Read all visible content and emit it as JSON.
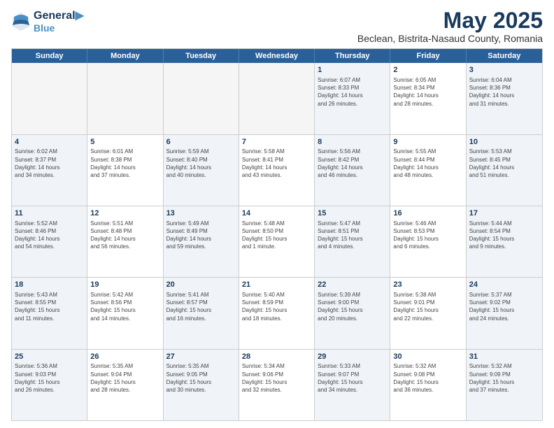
{
  "logo": {
    "line1": "General",
    "line2": "Blue"
  },
  "title": "May 2025",
  "subtitle": "Beclean, Bistrita-Nasaud County, Romania",
  "header_days": [
    "Sunday",
    "Monday",
    "Tuesday",
    "Wednesday",
    "Thursday",
    "Friday",
    "Saturday"
  ],
  "rows": [
    [
      {
        "day": "",
        "info": "",
        "empty": true
      },
      {
        "day": "",
        "info": "",
        "empty": true
      },
      {
        "day": "",
        "info": "",
        "empty": true
      },
      {
        "day": "",
        "info": "",
        "empty": true
      },
      {
        "day": "1",
        "info": "Sunrise: 6:07 AM\nSunset: 8:33 PM\nDaylight: 14 hours\nand 26 minutes."
      },
      {
        "day": "2",
        "info": "Sunrise: 6:05 AM\nSunset: 8:34 PM\nDaylight: 14 hours\nand 28 minutes."
      },
      {
        "day": "3",
        "info": "Sunrise: 6:04 AM\nSunset: 8:36 PM\nDaylight: 14 hours\nand 31 minutes."
      }
    ],
    [
      {
        "day": "4",
        "info": "Sunrise: 6:02 AM\nSunset: 8:37 PM\nDaylight: 14 hours\nand 34 minutes."
      },
      {
        "day": "5",
        "info": "Sunrise: 6:01 AM\nSunset: 8:38 PM\nDaylight: 14 hours\nand 37 minutes."
      },
      {
        "day": "6",
        "info": "Sunrise: 5:59 AM\nSunset: 8:40 PM\nDaylight: 14 hours\nand 40 minutes."
      },
      {
        "day": "7",
        "info": "Sunrise: 5:58 AM\nSunset: 8:41 PM\nDaylight: 14 hours\nand 43 minutes."
      },
      {
        "day": "8",
        "info": "Sunrise: 5:56 AM\nSunset: 8:42 PM\nDaylight: 14 hours\nand 46 minutes."
      },
      {
        "day": "9",
        "info": "Sunrise: 5:55 AM\nSunset: 8:44 PM\nDaylight: 14 hours\nand 48 minutes."
      },
      {
        "day": "10",
        "info": "Sunrise: 5:53 AM\nSunset: 8:45 PM\nDaylight: 14 hours\nand 51 minutes."
      }
    ],
    [
      {
        "day": "11",
        "info": "Sunrise: 5:52 AM\nSunset: 8:46 PM\nDaylight: 14 hours\nand 54 minutes."
      },
      {
        "day": "12",
        "info": "Sunrise: 5:51 AM\nSunset: 8:48 PM\nDaylight: 14 hours\nand 56 minutes."
      },
      {
        "day": "13",
        "info": "Sunrise: 5:49 AM\nSunset: 8:49 PM\nDaylight: 14 hours\nand 59 minutes."
      },
      {
        "day": "14",
        "info": "Sunrise: 5:48 AM\nSunset: 8:50 PM\nDaylight: 15 hours\nand 1 minute."
      },
      {
        "day": "15",
        "info": "Sunrise: 5:47 AM\nSunset: 8:51 PM\nDaylight: 15 hours\nand 4 minutes."
      },
      {
        "day": "16",
        "info": "Sunrise: 5:46 AM\nSunset: 8:53 PM\nDaylight: 15 hours\nand 6 minutes."
      },
      {
        "day": "17",
        "info": "Sunrise: 5:44 AM\nSunset: 8:54 PM\nDaylight: 15 hours\nand 9 minutes."
      }
    ],
    [
      {
        "day": "18",
        "info": "Sunrise: 5:43 AM\nSunset: 8:55 PM\nDaylight: 15 hours\nand 11 minutes."
      },
      {
        "day": "19",
        "info": "Sunrise: 5:42 AM\nSunset: 8:56 PM\nDaylight: 15 hours\nand 14 minutes."
      },
      {
        "day": "20",
        "info": "Sunrise: 5:41 AM\nSunset: 8:57 PM\nDaylight: 15 hours\nand 16 minutes."
      },
      {
        "day": "21",
        "info": "Sunrise: 5:40 AM\nSunset: 8:59 PM\nDaylight: 15 hours\nand 18 minutes."
      },
      {
        "day": "22",
        "info": "Sunrise: 5:39 AM\nSunset: 9:00 PM\nDaylight: 15 hours\nand 20 minutes."
      },
      {
        "day": "23",
        "info": "Sunrise: 5:38 AM\nSunset: 9:01 PM\nDaylight: 15 hours\nand 22 minutes."
      },
      {
        "day": "24",
        "info": "Sunrise: 5:37 AM\nSunset: 9:02 PM\nDaylight: 15 hours\nand 24 minutes."
      }
    ],
    [
      {
        "day": "25",
        "info": "Sunrise: 5:36 AM\nSunset: 9:03 PM\nDaylight: 15 hours\nand 26 minutes."
      },
      {
        "day": "26",
        "info": "Sunrise: 5:35 AM\nSunset: 9:04 PM\nDaylight: 15 hours\nand 28 minutes."
      },
      {
        "day": "27",
        "info": "Sunrise: 5:35 AM\nSunset: 9:05 PM\nDaylight: 15 hours\nand 30 minutes."
      },
      {
        "day": "28",
        "info": "Sunrise: 5:34 AM\nSunset: 9:06 PM\nDaylight: 15 hours\nand 32 minutes."
      },
      {
        "day": "29",
        "info": "Sunrise: 5:33 AM\nSunset: 9:07 PM\nDaylight: 15 hours\nand 34 minutes."
      },
      {
        "day": "30",
        "info": "Sunrise: 5:32 AM\nSunset: 9:08 PM\nDaylight: 15 hours\nand 36 minutes."
      },
      {
        "day": "31",
        "info": "Sunrise: 5:32 AM\nSunset: 9:09 PM\nDaylight: 15 hours\nand 37 minutes."
      }
    ]
  ]
}
